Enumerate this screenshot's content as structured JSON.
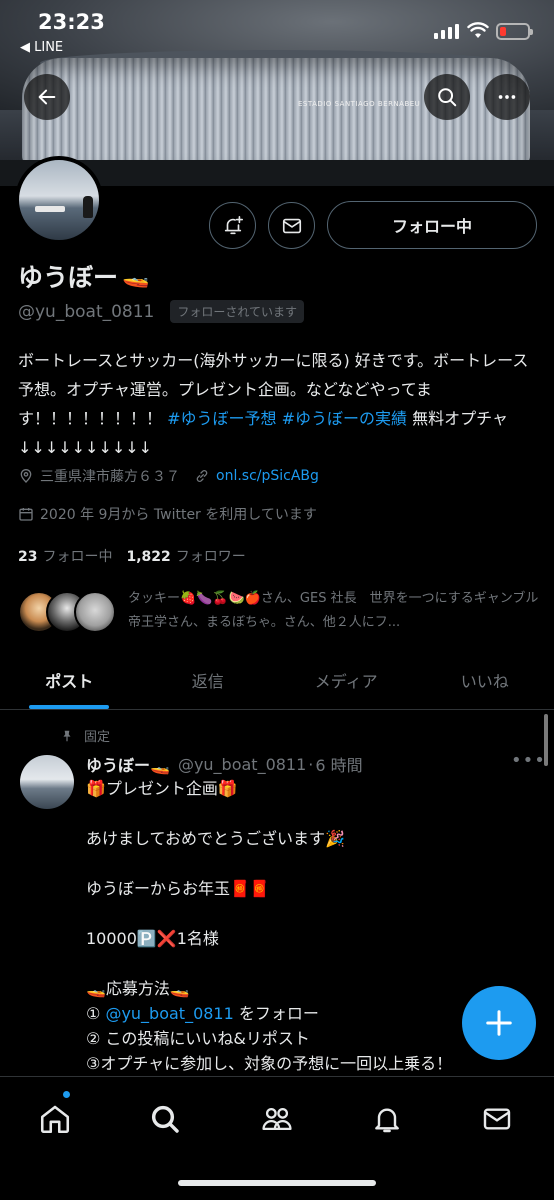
{
  "status_bar": {
    "time": "23:23",
    "back_app": "◀ LINE"
  },
  "banner": {
    "stadium_name": "ESTADIO SANTIAGO BERNABEU"
  },
  "profile": {
    "name": "ゆうぼー",
    "name_emoji": "🚤",
    "handle": "@yu_boat_0811",
    "follows_you": "フォローされています",
    "follow_button": "フォロー中",
    "bio_text": "ボートレースとサッカー(海外サッカーに限る) 好きです。ボートレース予想。オプチャ運営。プレゼント企画。などなどやってます！！！！！！！！",
    "bio_tag1": "#ゆうぼー予想",
    "bio_tag2": "#ゆうぼーの実績",
    "bio_tail": "無料オプチャ ↓↓↓↓↓↓↓↓↓↓",
    "location": "三重県津市藤方６３７",
    "url": "onl.sc/pSicABg",
    "joined": "2020 年 9月から Twitter を利用しています",
    "following_count": "23",
    "following_label": "フォロー中",
    "followers_count": "1,822",
    "followers_label": "フォロワー",
    "followed_by": "タッキー🍓🍆🍒🍉🍎さん、GES 社長　世界を一つにするギャンブル帝王学さん、まるぼちゃ。さん、他２人にフ..."
  },
  "tabs": [
    "ポスト",
    "返信",
    "メディア",
    "いいね"
  ],
  "post": {
    "pinned_label": "固定",
    "author": "ゆうぼー🚤",
    "handle": "@yu_boat_0811",
    "dot": "·",
    "time": "6 時間",
    "more": "•••",
    "line1": "🎁プレゼント企画🎁",
    "line2": "あけましておめでとうございます🎉",
    "line3": "ゆうぼーからお年玉🧧🧧",
    "line4": "10000🅿️❌1名様",
    "line5": "🚤応募方法🚤",
    "line6_pre": "① ",
    "line6_link": "@yu_boat_0811",
    "line6_post": " をフォロー",
    "line7": "② この投稿にいいね&リポスト",
    "line8": "③オプチャに参加し、対象の予想に一回以上乗る！"
  },
  "colors": {
    "accent": "#1d9bf0",
    "background": "#000000",
    "secondary_text": "#71767b"
  },
  "nav": [
    "home-icon",
    "search-icon",
    "communities-icon",
    "notifications-icon",
    "messages-icon"
  ]
}
